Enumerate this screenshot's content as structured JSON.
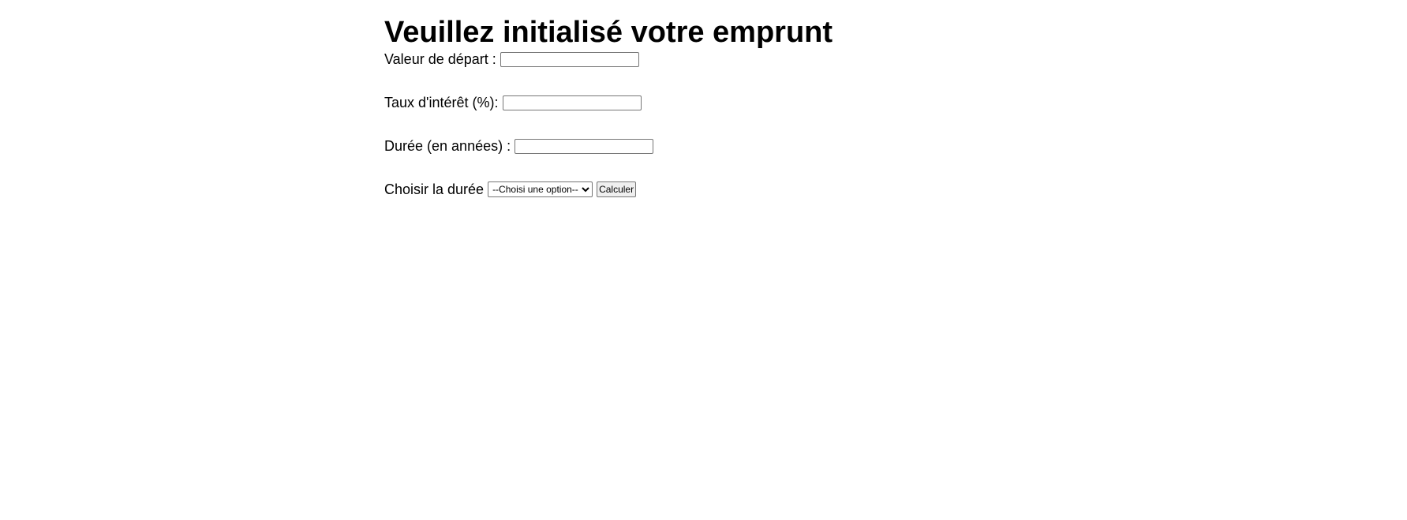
{
  "title": "Veuillez initialisé votre emprunt",
  "form": {
    "start_value": {
      "label": "Valeur de départ :",
      "value": ""
    },
    "interest_rate": {
      "label": "Taux d'intérêt (%):",
      "value": ""
    },
    "duration": {
      "label": "Durée (en années) :",
      "value": ""
    },
    "duration_choice": {
      "label": "Choisir la durée",
      "selected_option": "--Choisi une option--"
    },
    "submit_label": "Calculer"
  }
}
